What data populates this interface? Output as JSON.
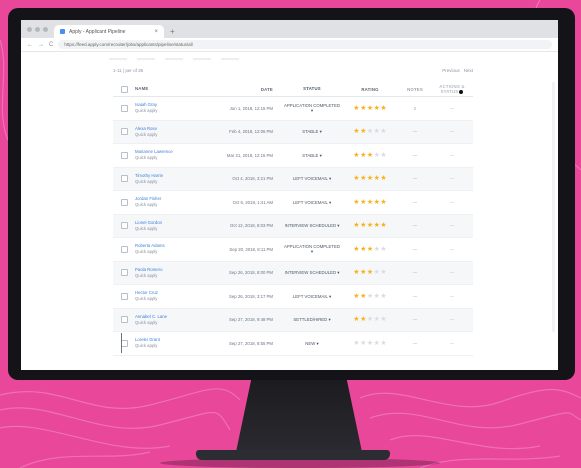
{
  "browser": {
    "tab_title": "Apply - Applicant Pipeline",
    "tab_close": "×",
    "new_tab": "+",
    "back": "←",
    "forward": "→",
    "reload": "C",
    "url": "https://feed.apply.com/recruiter/jobs/applicants/pipeline/status/all"
  },
  "toolbar": {
    "count_label": "1-11 | per of 35",
    "pager_text": "Previous",
    "pager_next": "Next"
  },
  "table": {
    "columns": {
      "name": "NAME",
      "date": "DATE",
      "status": "STATUS",
      "rating": "RATING",
      "notes": "NOTES",
      "actions": "ACTIONS & STATUS"
    },
    "rows": [
      {
        "name": "Isaiah Gray",
        "sub": "Quick apply",
        "date": "Jun 1, 2018, 12:15 PM",
        "status": "APPLICATION COMPLETED",
        "rating": 5,
        "notes": "2",
        "actions": "—"
      },
      {
        "name": "Alexa Rose",
        "sub": "Quick apply",
        "date": "Feb 4, 2018, 12:06 PM",
        "status": "STABLE",
        "rating": 2,
        "notes": "—",
        "actions": "—"
      },
      {
        "name": "Marianne Lawrence",
        "sub": "Quick apply",
        "date": "Mar 21, 2018, 12:15 PM",
        "status": "STABLE",
        "rating": 3,
        "notes": "—",
        "actions": "—"
      },
      {
        "name": "Timothy Harrie",
        "sub": "Quick apply",
        "date": "Oct 4, 2018, 3:21 PM",
        "status": "LEFT VOICEMAIL",
        "rating": 5,
        "notes": "—",
        "actions": "—"
      },
      {
        "name": "Jordan Fisher",
        "sub": "Quick apply",
        "date": "Oct 6, 2018, 1:41 AM",
        "status": "LEFT VOICEMAIL",
        "rating": 5,
        "notes": "—",
        "actions": "—"
      },
      {
        "name": "Lionel Gordon",
        "sub": "Quick apply",
        "date": "Oct 12, 2018, 8:03 PM",
        "status": "INTERVIEW SCHEDULED",
        "rating": 5,
        "notes": "—",
        "actions": "—"
      },
      {
        "name": "Roberta Adams",
        "sub": "Quick apply",
        "date": "Sep 20, 2018, 8:11 PM",
        "status": "APPLICATION COMPLETED",
        "rating": 3,
        "notes": "—",
        "actions": "—"
      },
      {
        "name": "Paola Romero",
        "sub": "Quick apply",
        "date": "Sep 26, 2018, 8:00 PM",
        "status": "INTERVIEW SCHEDULED",
        "rating": 3,
        "notes": "—",
        "actions": "—"
      },
      {
        "name": "Hector Cruz",
        "sub": "Quick apply",
        "date": "Sep 26, 2018, 3:17 PM",
        "status": "LEFT VOICEMAIL",
        "rating": 2,
        "notes": "—",
        "actions": "—"
      },
      {
        "name": "Annabel C. Lane",
        "sub": "Quick apply",
        "date": "Sep 27, 2018, 9:48 PM",
        "status": "SETTLED/HIRED",
        "rating": 2,
        "notes": "—",
        "actions": "—"
      },
      {
        "name": "Lorelei Grant",
        "sub": "Quick apply",
        "date": "Sep 27, 2018, 8:55 PM",
        "status": "NEW",
        "rating": 0,
        "notes": "—",
        "actions": "—"
      }
    ]
  },
  "colors": {
    "background": "#e8479a",
    "accent_link": "#3b7fd9",
    "star": "#f6b21a"
  }
}
